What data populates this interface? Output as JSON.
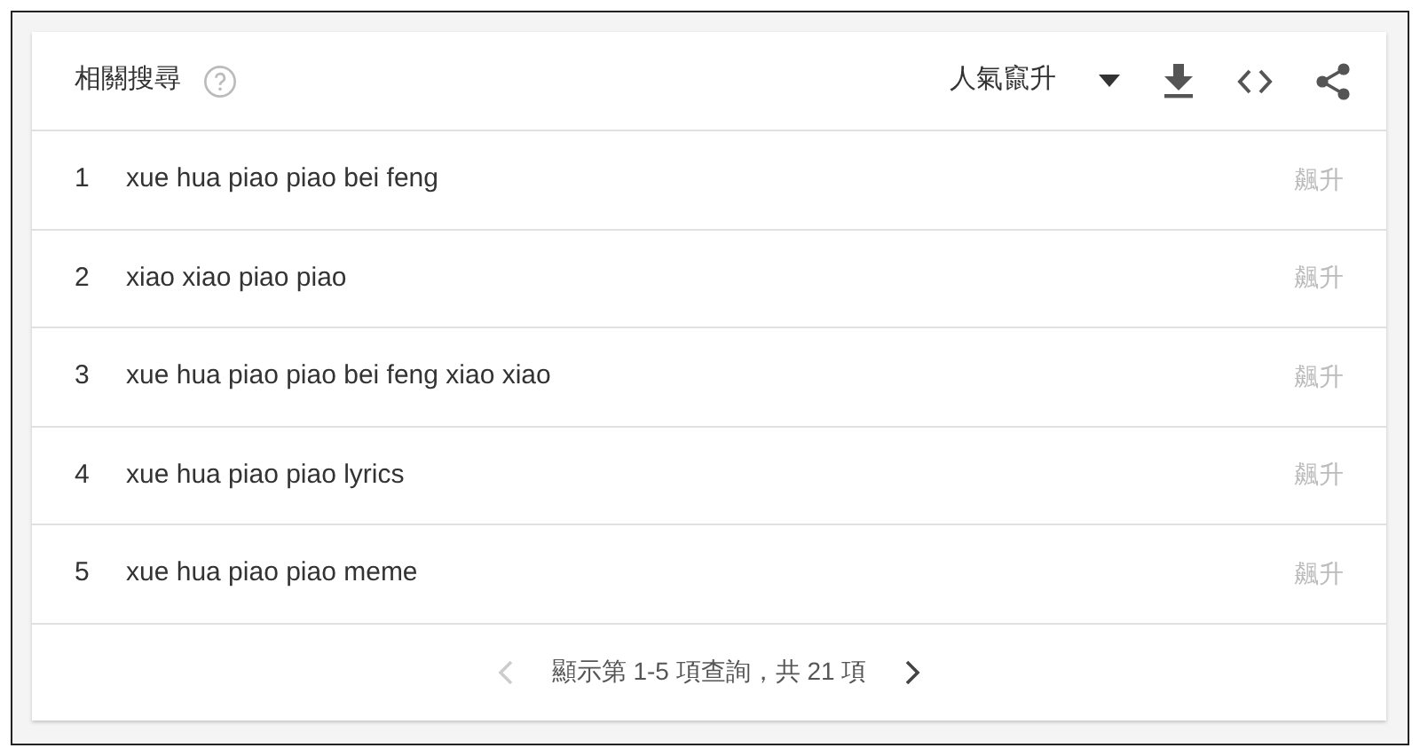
{
  "header": {
    "title": "相關搜尋",
    "sort": "人氣竄升"
  },
  "rows": [
    {
      "rank": "1",
      "query": "xue hua piao piao bei feng",
      "value": "飆升"
    },
    {
      "rank": "2",
      "query": "xiao xiao piao piao",
      "value": "飆升"
    },
    {
      "rank": "3",
      "query": "xue hua piao piao bei feng xiao xiao",
      "value": "飆升"
    },
    {
      "rank": "4",
      "query": "xue hua piao piao lyrics",
      "value": "飆升"
    },
    {
      "rank": "5",
      "query": "xue hua piao piao meme",
      "value": "飆升"
    }
  ],
  "pagination": {
    "text": "顯示第 1-5 項查詢，共 21 項",
    "prev_disabled": true,
    "next_disabled": false
  }
}
